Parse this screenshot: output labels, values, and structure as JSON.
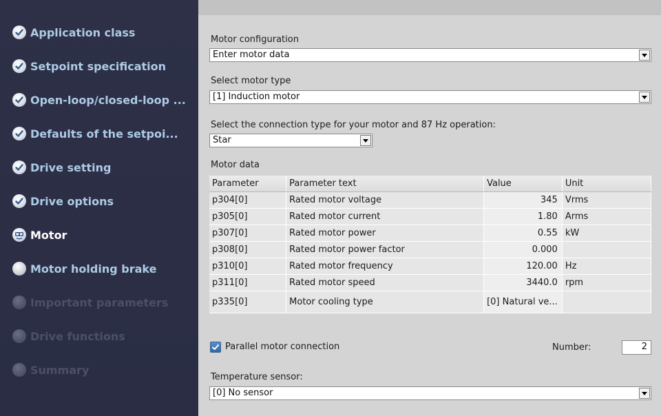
{
  "sidebar": {
    "items": [
      {
        "label": "Application class",
        "state": "done"
      },
      {
        "label": "Setpoint specification",
        "state": "done"
      },
      {
        "label": "Open-loop/closed-loop ...",
        "state": "done"
      },
      {
        "label": "Defaults of the setpoi...",
        "state": "done"
      },
      {
        "label": "Drive setting",
        "state": "done"
      },
      {
        "label": "Drive options",
        "state": "done"
      },
      {
        "label": "Motor",
        "state": "active"
      },
      {
        "label": "Motor holding brake",
        "state": "todo"
      },
      {
        "label": "Important parameters",
        "state": "disabled"
      },
      {
        "label": "Drive functions",
        "state": "disabled"
      },
      {
        "label": "Summary",
        "state": "disabled"
      }
    ]
  },
  "main": {
    "motor_config": {
      "label": "Motor configuration",
      "value": "Enter motor data"
    },
    "motor_type": {
      "label": "Select motor type",
      "value": "[1] Induction motor"
    },
    "connection": {
      "label": "Select the connection type for your motor and 87 Hz operation:",
      "value": "Star"
    },
    "motor_data": {
      "label": "Motor data",
      "columns": [
        "Parameter",
        "Parameter text",
        "Value",
        "Unit"
      ],
      "rows": [
        {
          "param": "p304[0]",
          "text": "Rated motor voltage",
          "value": "345",
          "unit": "Vrms"
        },
        {
          "param": "p305[0]",
          "text": "Rated motor current",
          "value": "1.80",
          "unit": "Arms"
        },
        {
          "param": "p307[0]",
          "text": "Rated motor power",
          "value": "0.55",
          "unit": "kW"
        },
        {
          "param": "p308[0]",
          "text": "Rated motor power factor",
          "value": "0.000",
          "unit": ""
        },
        {
          "param": "p310[0]",
          "text": "Rated motor frequency",
          "value": "120.00",
          "unit": "Hz"
        },
        {
          "param": "p311[0]",
          "text": "Rated motor speed",
          "value": "3440.0",
          "unit": "rpm"
        },
        {
          "param": "p335[0]",
          "text": "Motor cooling type",
          "value": "[0] Natural ve...",
          "unit": ""
        }
      ]
    },
    "parallel": {
      "label": "Parallel motor connection",
      "checked": true,
      "number_label": "Number:",
      "number_value": "2"
    },
    "temp_sensor": {
      "label": "Temperature sensor:",
      "value": "[0] No sensor"
    }
  }
}
